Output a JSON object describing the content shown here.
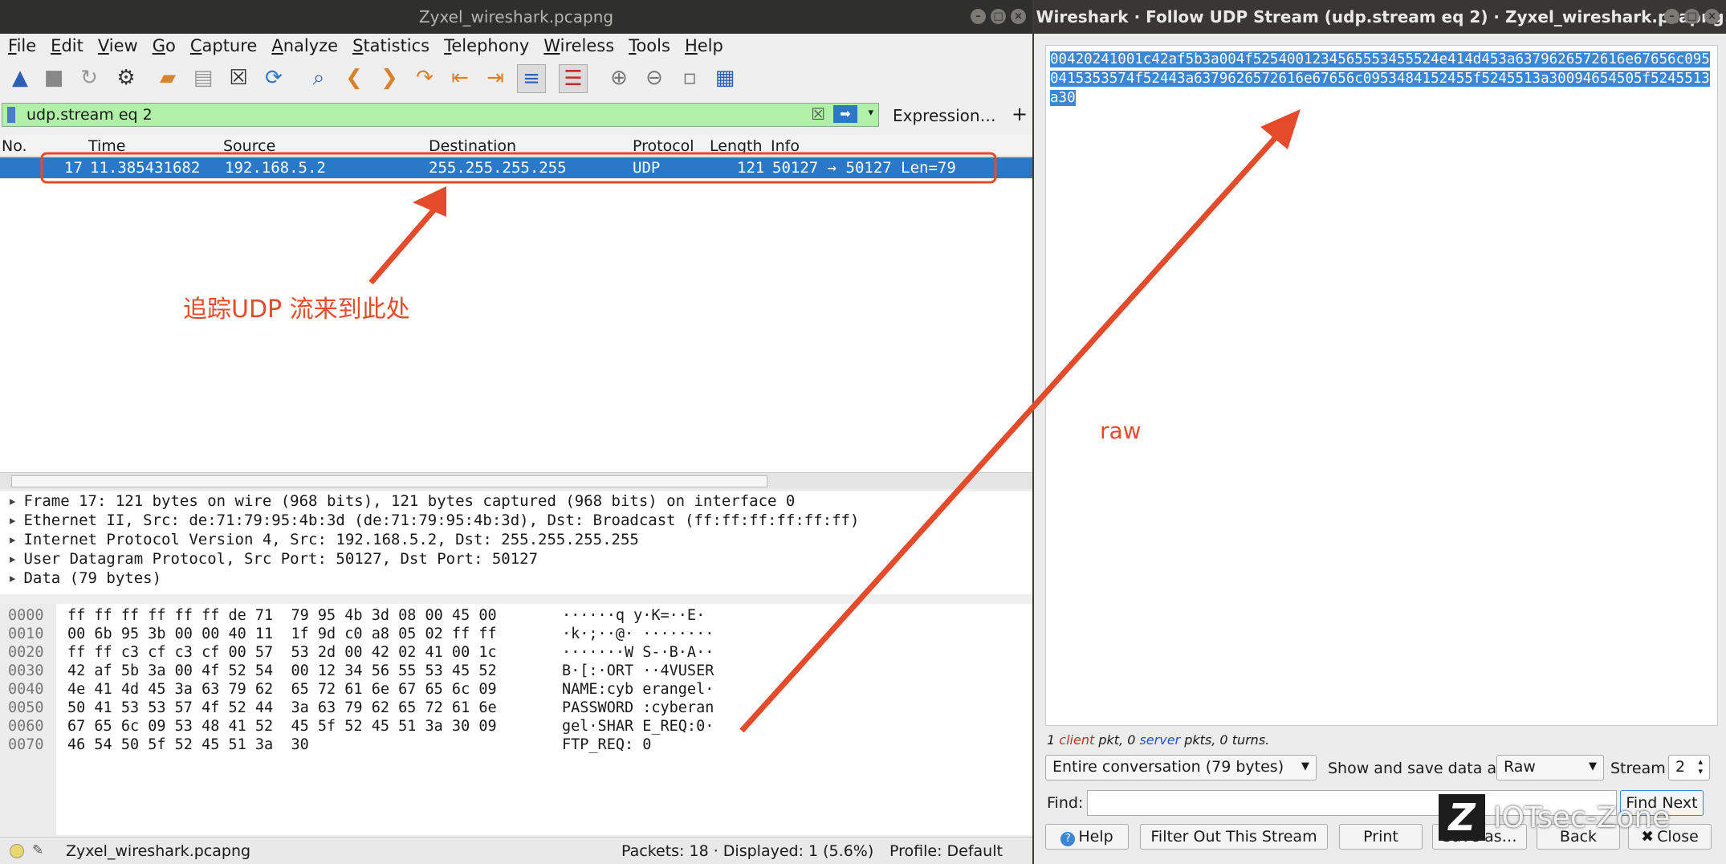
{
  "main_window": {
    "title": "Zyxel_wireshark.pcapng",
    "menu": [
      "File",
      "Edit",
      "View",
      "Go",
      "Capture",
      "Analyze",
      "Statistics",
      "Telephony",
      "Wireless",
      "Tools",
      "Help"
    ],
    "toolbar_icons": [
      "shark-fin-start-icon",
      "stop-icon",
      "restart-icon",
      "options-gear-icon",
      "open-folder-icon",
      "save-file-icon",
      "close-file-icon",
      "reload-icon",
      "find-magnifier-icon",
      "back-arrow-icon",
      "forward-arrow-icon",
      "go-to-packet-icon",
      "first-packet-icon",
      "last-packet-icon",
      "autoscroll-icon",
      "colorize-icon",
      "zoom-in-icon",
      "zoom-out-icon",
      "normal-size-icon",
      "resize-columns-icon"
    ],
    "filter": {
      "value": "udp.stream eq 2",
      "expression_label": "Expression…",
      "plus_label": "+"
    },
    "columns": [
      "No.",
      "Time",
      "Source",
      "Destination",
      "Protocol",
      "Length",
      "Info"
    ],
    "packet": {
      "no": "17",
      "time": "11.385431682",
      "source": "192.168.5.2",
      "destination": "255.255.255.255",
      "protocol": "UDP",
      "length": "121",
      "info": "50127 → 50127 Len=79"
    },
    "details": [
      "Frame 17: 121 bytes on wire (968 bits), 121 bytes captured (968 bits) on interface 0",
      "Ethernet II, Src: de:71:79:95:4b:3d (de:71:79:95:4b:3d), Dst: Broadcast (ff:ff:ff:ff:ff:ff)",
      "Internet Protocol Version 4, Src: 192.168.5.2, Dst: 255.255.255.255",
      "User Datagram Protocol, Src Port: 50127, Dst Port: 50127",
      "Data (79 bytes)"
    ],
    "bytes": [
      {
        "off": "0000",
        "hex": "ff ff ff ff ff ff de 71  79 95 4b 3d 08 00 45 00",
        "asc": "······q y·K=··E·"
      },
      {
        "off": "0010",
        "hex": "00 6b 95 3b 00 00 40 11  1f 9d c0 a8 05 02 ff ff",
        "asc": "·k·;··@· ········"
      },
      {
        "off": "0020",
        "hex": "ff ff c3 cf c3 cf 00 57  53 2d 00 42 02 41 00 1c",
        "asc": "·······W S-·B·A··"
      },
      {
        "off": "0030",
        "hex": "42 af 5b 3a 00 4f 52 54  00 12 34 56 55 53 45 52",
        "asc": "B·[:·ORT ··4VUSER"
      },
      {
        "off": "0040",
        "hex": "4e 41 4d 45 3a 63 79 62  65 72 61 6e 67 65 6c 09",
        "asc": "NAME:cyb erangel·"
      },
      {
        "off": "0050",
        "hex": "50 41 53 53 57 4f 52 44  3a 63 79 62 65 72 61 6e",
        "asc": "PASSWORD :cyberan"
      },
      {
        "off": "0060",
        "hex": "67 65 6c 09 53 48 41 52  45 5f 52 45 51 3a 30 09",
        "asc": "gel·SHAR E_REQ:0·"
      },
      {
        "off": "0070",
        "hex": "46 54 50 5f 52 45 51 3a  30",
        "asc": "FTP_REQ: 0"
      }
    ],
    "status": {
      "file": "Zyxel_wireshark.pcapng",
      "packets": "Packets: 18 · Displayed: 1 (5.6%)",
      "profile": "Profile: Default"
    },
    "annotation": "追踪UDP 流来到此处"
  },
  "follow_window": {
    "title": "Wireshark · Follow UDP Stream (udp.stream eq 2) · Zyxel_wireshark.pcapng",
    "stream_text": "00420241001c42af5b3a004f5254001234565553455524e414d453a6379626572616e67656c0950415353574f52443a6379626572616e67656c0953484152455f5245513a30094654505f5245513a30",
    "raw_annotation": "raw",
    "summary": {
      "client_count": "1",
      "client_word": "client",
      "mid": "pkt, 0",
      "server_word": "server",
      "tail": "pkts, 0 turns."
    },
    "conversation_select": "Entire conversation (79 bytes)",
    "show_label": "Show and save data as",
    "show_select": "Raw",
    "stream_label": "Stream",
    "stream_value": "2",
    "find_label": "Find:",
    "find_next": "Find Next",
    "buttons": {
      "help": "Help",
      "filter_out": "Filter Out This Stream",
      "print": "Print",
      "save_as": "Save as…",
      "back": "Back",
      "close": "Close"
    }
  },
  "watermark": {
    "logo_letter": "Z",
    "text": "IOTsec-Zone"
  },
  "colors": {
    "selected_row": "#2b78c6",
    "filter_ok": "#b0f0a8",
    "annotation_red": "#e44b2b"
  }
}
